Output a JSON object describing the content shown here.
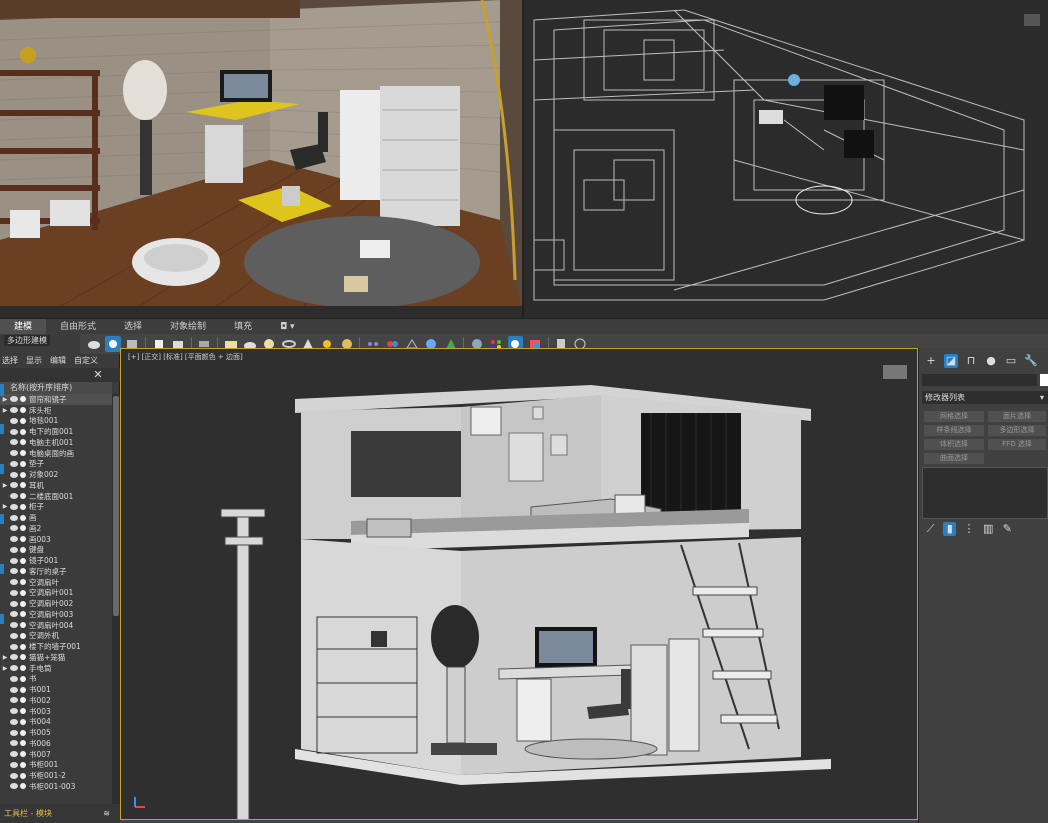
{
  "ribbon": {
    "tabs": [
      "建模",
      "自由形式",
      "选择",
      "对象绘制",
      "填充"
    ],
    "active_tab": "建模",
    "poly_label": "多边形建模"
  },
  "explorer": {
    "menu": [
      "选择",
      "显示",
      "编辑",
      "自定义"
    ],
    "header": "名称(按升序排序)",
    "items": [
      "窗帘和镜子",
      "床头柜",
      "地毯001",
      "电下的面001",
      "电脑主机001",
      "电脑桌面的画",
      "垫子",
      "对象002",
      "耳机",
      "二楼底面001",
      "柜子",
      "画",
      "画2",
      "画003",
      "键盘",
      "镜子001",
      "客厅的桌子",
      "空调扇叶",
      "空调扇叶001",
      "空调扇叶002",
      "空调扇叶003",
      "空调扇叶004",
      "空调外机",
      "楼下的墙子001",
      "猫猫+笼猫",
      "手电筒",
      "书",
      "书001",
      "书002",
      "书003",
      "书004",
      "书005",
      "书006",
      "书007",
      "书柜001",
      "书柜001-2",
      "书柜001-003"
    ],
    "expandable": [
      "窗帘和镜子",
      "床头柜",
      "耳机",
      "柜子",
      "猫猫+笼猫",
      "手电筒"
    ],
    "footer": "工具栏 - 模块"
  },
  "viewport_front": {
    "label": "[+] [正交] [标准] [平面颜色 + 边面]"
  },
  "command_panel": {
    "modifier_list": "修改器列表",
    "buttons": [
      "网格选择",
      "面片选择",
      "样条线选择",
      "多边形选择",
      "体积选择",
      "FFD 选择",
      "曲面选择"
    ]
  },
  "icons": {
    "ribbon": [
      "teapot-icon",
      "sphere-icon",
      "box-icon",
      "light-icon",
      "camera-icon",
      "plane-icon",
      "cone-icon",
      "sun-icon",
      "dots-icon",
      "link-icon",
      "material-icon",
      "render-icon",
      "help-icon"
    ],
    "command_panel": [
      "create-icon",
      "modify-icon",
      "hierarchy-icon",
      "motion-icon",
      "display-icon",
      "utilities-icon"
    ]
  },
  "colors": {
    "selection_blue": "#2a7fc1",
    "active_viewport_border": "#c8a030",
    "footer_text": "#e0c040"
  }
}
